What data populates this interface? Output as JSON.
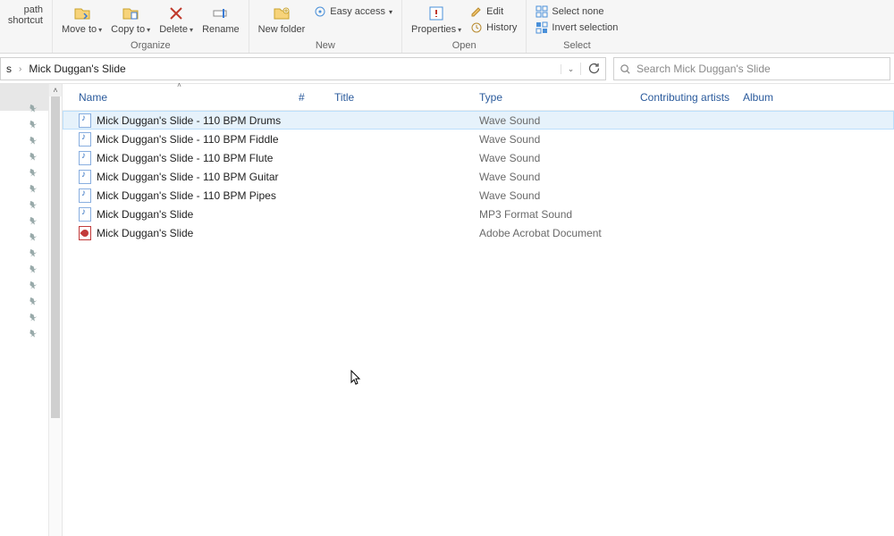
{
  "ribbon": {
    "clipboard": {
      "copy_path": "path",
      "paste_shortcut": "shortcut"
    },
    "organize": {
      "move_to": "Move to",
      "copy_to": "Copy to",
      "delete": "Delete",
      "rename": "Rename",
      "group_label": "Organize"
    },
    "new": {
      "new_folder": "New folder",
      "easy_access": "Easy access",
      "group_label": "New"
    },
    "open": {
      "properties": "Properties",
      "edit": "Edit",
      "history": "History",
      "group_label": "Open"
    },
    "select": {
      "select_none": "Select none",
      "invert": "Invert selection",
      "group_label": "Select"
    }
  },
  "addressbar": {
    "tail_prefix": "s",
    "folder": "Mick Duggan's Slide"
  },
  "search": {
    "placeholder": "Search Mick Duggan's Slide"
  },
  "columns": {
    "name": "Name",
    "num": "#",
    "title": "Title",
    "type": "Type",
    "artists": "Contributing artists",
    "album": "Album"
  },
  "files": [
    {
      "icon": "audio",
      "name": "Mick Duggan's Slide - 110 BPM Drums",
      "type": "Wave Sound",
      "selected": true
    },
    {
      "icon": "audio",
      "name": "Mick Duggan's Slide - 110 BPM Fiddle",
      "type": "Wave Sound"
    },
    {
      "icon": "audio",
      "name": "Mick Duggan's Slide - 110 BPM Flute",
      "type": "Wave Sound"
    },
    {
      "icon": "audio",
      "name": "Mick Duggan's Slide - 110 BPM Guitar",
      "type": "Wave Sound"
    },
    {
      "icon": "audio",
      "name": "Mick Duggan's Slide - 110 BPM Pipes",
      "type": "Wave Sound"
    },
    {
      "icon": "audio",
      "name": "Mick Duggan's Slide",
      "type": "MP3 Format Sound"
    },
    {
      "icon": "pdf",
      "name": "Mick Duggan's Slide",
      "type": "Adobe Acrobat Document"
    }
  ],
  "pins_count": 15
}
